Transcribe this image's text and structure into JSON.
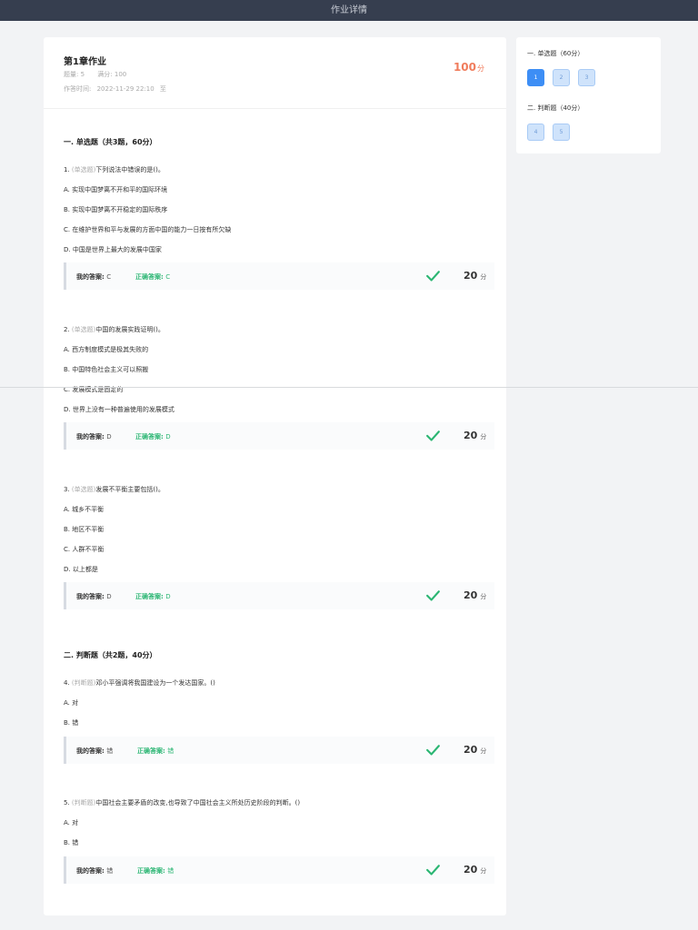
{
  "topbar": {
    "title": "作业详情"
  },
  "homework": {
    "title": "第1章作业",
    "count_label": "题量: 5",
    "full_score_label": "满分: 100",
    "time_label": "作答时间:",
    "time_start": "2022-11-29 22:10",
    "time_sep": "至",
    "score": "100",
    "score_unit": "分"
  },
  "sections": [
    {
      "title": "一. 单选题（共3题，60分）"
    },
    {
      "title": "二. 判断题（共2题，40分）"
    }
  ],
  "questions": [
    {
      "num": "1.",
      "type": "(单选题)",
      "stem": "下列说法中错误的是()。",
      "options": [
        "A. 实现中国梦离不开和平的国际环境",
        "B. 实现中国梦离不开稳定的国际秩序",
        "C. 在维护世界和平与发展的方面中国的能力一日按有所欠缺",
        "D. 中国是世界上最大的发展中国家"
      ],
      "my_label": "我的答案:",
      "my": "C",
      "correct_label": "正确答案:",
      "correct": "C",
      "score": "20",
      "unit": "分"
    },
    {
      "num": "2.",
      "type": "(单选题)",
      "stem": "中国的发展实践证明()。",
      "options": [
        "A. 西方制度模式是极其失败的",
        "B. 中国特色社会主义可以照搬",
        "C. 发展模式是固定的",
        "D. 世界上没有一种普遍使用的发展模式"
      ],
      "my_label": "我的答案:",
      "my": "D",
      "correct_label": "正确答案:",
      "correct": "D",
      "score": "20",
      "unit": "分"
    },
    {
      "num": "3.",
      "type": "(单选题)",
      "stem": "发展不平衡主要包括()。",
      "options": [
        "A. 城乡不平衡",
        "B. 地区不平衡",
        "C. 人群不平衡",
        "D. 以上都是"
      ],
      "my_label": "我的答案:",
      "my": "D",
      "correct_label": "正确答案:",
      "correct": "D",
      "score": "20",
      "unit": "分"
    },
    {
      "num": "4.",
      "type": "(判断题)",
      "stem": "邓小平强调将我国建设为一个发达国家。()",
      "options": [
        "A. 对",
        "B. 错"
      ],
      "my_label": "我的答案:",
      "my": "错",
      "correct_label": "正确答案:",
      "correct": "错",
      "score": "20",
      "unit": "分"
    },
    {
      "num": "5.",
      "type": "(判断题)",
      "stem": "中国社会主要矛盾的改变,也导致了中国社会主义所处历史阶段的判断。()",
      "options": [
        "A. 对",
        "B. 错"
      ],
      "my_label": "我的答案:",
      "my": "错",
      "correct_label": "正确答案:",
      "correct": "错",
      "score": "20",
      "unit": "分"
    }
  ],
  "nav": {
    "sections": [
      {
        "title": "一. 单选题（60分）",
        "items": [
          "1",
          "2",
          "3"
        ]
      },
      {
        "title": "二. 判断题（40分）",
        "items": [
          "4",
          "5"
        ]
      }
    ],
    "active": "1"
  },
  "colors": {
    "topbar": "#363e4f",
    "accent": "#3d8ef5",
    "correct": "#2bb673",
    "score": "#f07c5c"
  }
}
